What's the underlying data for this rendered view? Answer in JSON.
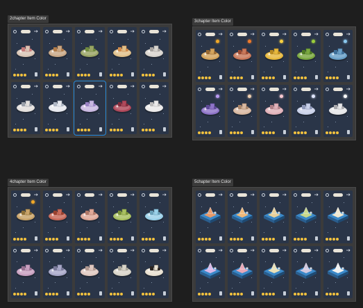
{
  "frames": [
    {
      "id": "chapter2",
      "label": "2chapter Item Color",
      "style": "round",
      "selected_index": 7,
      "cards": [
        {
          "primary": "#d8c5b5",
          "accent": "#c57a7a",
          "orb": ""
        },
        {
          "primary": "#c9a887",
          "accent": "#b07a48",
          "orb": ""
        },
        {
          "primary": "#9aa566",
          "accent": "#6f8a3e",
          "orb": ""
        },
        {
          "primary": "#e0c08a",
          "accent": "#d08a4a",
          "orb": ""
        },
        {
          "primary": "#d8d4ce",
          "accent": "#a8a4a0",
          "orb": ""
        },
        {
          "primary": "#e3e0dd",
          "accent": "#9aa0aa",
          "orb": ""
        },
        {
          "primary": "#e6e8ee",
          "accent": "#aeb6c4",
          "orb": ""
        },
        {
          "primary": "#c9b8e0",
          "accent": "#9a82c4",
          "orb": ""
        },
        {
          "primary": "#b0485a",
          "accent": "#7e2a3a",
          "orb": ""
        },
        {
          "primary": "#ebeaea",
          "accent": "#bdbcbc",
          "orb": ""
        }
      ]
    },
    {
      "id": "chapter3",
      "label": "3chapter Item Color",
      "style": "round",
      "selected_index": -1,
      "cards": [
        {
          "primary": "#d4a45c",
          "accent": "#9a6a32",
          "orb": "#f0a828"
        },
        {
          "primary": "#c9785a",
          "accent": "#9a4a32",
          "orb": "#f07a2a"
        },
        {
          "primary": "#e6b83c",
          "accent": "#b88a20",
          "orb": "#f8d040"
        },
        {
          "primary": "#7aa840",
          "accent": "#4e7a24",
          "orb": "#9acd3a"
        },
        {
          "primary": "#6aa0c8",
          "accent": "#3e6e98",
          "orb": "#8ac8f0"
        },
        {
          "primary": "#8e74c8",
          "accent": "#5e4a98",
          "orb": "#b89af0"
        },
        {
          "primary": "#d8b8a0",
          "accent": "#a88468",
          "orb": "#f0d0b0"
        },
        {
          "primary": "#e0b0b8",
          "accent": "#b08088",
          "orb": "#f8c8d0"
        },
        {
          "primary": "#c8d0e8",
          "accent": "#8e98b8",
          "orb": "#dfe6ff"
        },
        {
          "primary": "#e6e6e8",
          "accent": "#a8a8ac",
          "orb": "#ffffff"
        }
      ]
    },
    {
      "id": "chapter4",
      "label": "4chapter Item Color",
      "style": "round",
      "selected_index": -1,
      "cards": [
        {
          "primary": "#c9a46a",
          "accent": "#8e7038",
          "orb": "#f0a828"
        },
        {
          "primary": "#c86a5a",
          "accent": "#98402e",
          "orb": ""
        },
        {
          "primary": "#e0a898",
          "accent": "#b07868",
          "orb": ""
        },
        {
          "primary": "#a8c060",
          "accent": "#789038",
          "orb": ""
        },
        {
          "primary": "#9ad0e8",
          "accent": "#6aa0b8",
          "orb": ""
        },
        {
          "primary": "#c8a0c0",
          "accent": "#987090",
          "orb": ""
        },
        {
          "primary": "#a8a8c8",
          "accent": "#787898",
          "orb": ""
        },
        {
          "primary": "#e0c8c0",
          "accent": "#b09890",
          "orb": ""
        },
        {
          "primary": "#d8d4c8",
          "accent": "#a8a498",
          "orb": ""
        },
        {
          "primary": "#e8e0d0",
          "accent": "#2a2420",
          "orb": ""
        }
      ]
    },
    {
      "id": "chapter5",
      "label": "5chapter Item Color",
      "style": "square",
      "selected_index": -1,
      "cards": [
        {
          "primary": "#e89a6a",
          "accent": "#3a88c8",
          "orb": ""
        },
        {
          "primary": "#f0b878",
          "accent": "#3a88c8",
          "orb": ""
        },
        {
          "primary": "#e8d09a",
          "accent": "#3a88c8",
          "orb": ""
        },
        {
          "primary": "#c8d88a",
          "accent": "#3a88c8",
          "orb": ""
        },
        {
          "primary": "#f0e8d0",
          "accent": "#3a88c8",
          "orb": ""
        },
        {
          "primary": "#d8b8e8",
          "accent": "#3a88c8",
          "orb": ""
        },
        {
          "primary": "#e8a8b8",
          "accent": "#3a88c8",
          "orb": ""
        },
        {
          "primary": "#e8e0b8",
          "accent": "#3a88c8",
          "orb": ""
        },
        {
          "primary": "#d0c8e0",
          "accent": "#3a88c8",
          "orb": ""
        },
        {
          "primary": "#f0f0f0",
          "accent": "#3a88c8",
          "orb": ""
        }
      ]
    }
  ]
}
